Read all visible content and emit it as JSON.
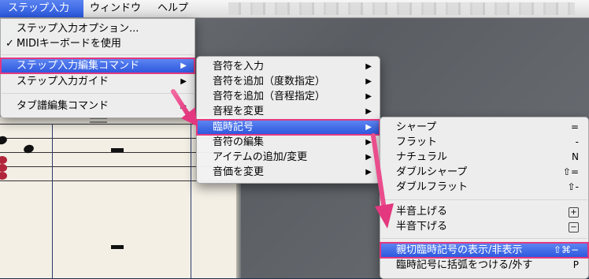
{
  "menubar": {
    "items": [
      "ステップ入力",
      "ウィンドウ",
      "ヘルプ"
    ]
  },
  "menu1": {
    "items": [
      {
        "label": "ステップ入力オプション..."
      },
      {
        "label": "MIDIキーボードを使用",
        "check": "✓"
      },
      {
        "label": "ステップ入力編集コマンド",
        "arrow": "▶"
      },
      {
        "label": "ステップ入力ガイド",
        "arrow": "▶"
      },
      {
        "label": "タブ譜編集コマンド",
        "arrow": "▶"
      }
    ]
  },
  "menu2": {
    "items": [
      {
        "label": "音符を入力",
        "arrow": "▶"
      },
      {
        "label": "音符を追加（度数指定）",
        "arrow": "▶"
      },
      {
        "label": "音符を追加（音程指定）",
        "arrow": "▶"
      },
      {
        "label": "音程を変更",
        "arrow": "▶"
      },
      {
        "label": "臨時記号",
        "arrow": "▶"
      },
      {
        "label": "音符の編集",
        "arrow": "▶"
      },
      {
        "label": "アイテムの追加/変更",
        "arrow": "▶"
      },
      {
        "label": "音価を変更",
        "arrow": "▶"
      }
    ]
  },
  "menu3": {
    "items": [
      {
        "label": "シャープ",
        "shortcut": "="
      },
      {
        "label": "フラット",
        "shortcut": "-"
      },
      {
        "label": "ナチュラル",
        "shortcut": "N"
      },
      {
        "label": "ダブルシャープ",
        "shortcut": "⇧="
      },
      {
        "label": "ダブルフラット",
        "shortcut": "⇧-"
      },
      {
        "label": "半音上げる",
        "shortcut": "+"
      },
      {
        "label": "半音下げる",
        "shortcut": "−"
      },
      {
        "label": "親切臨時記号の表示/非表示",
        "shortcut": "⇧⌘−"
      },
      {
        "label": "臨時記号に括弧をつける/外す",
        "shortcut": "P"
      }
    ]
  },
  "colors": {
    "highlight": "#2b56dd",
    "callout": "#e3387f"
  }
}
